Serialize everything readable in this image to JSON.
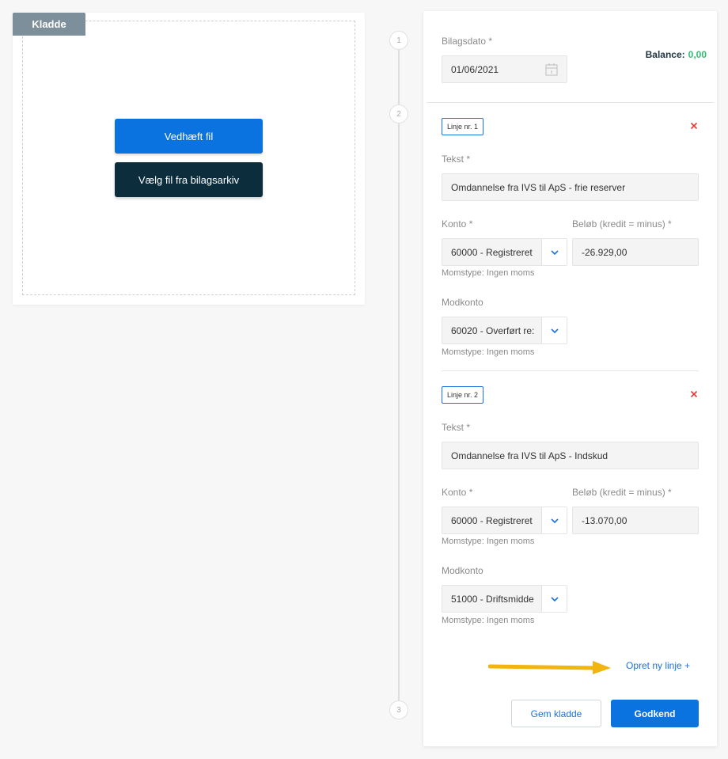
{
  "upload": {
    "tag": "Kladde",
    "attach_label": "Vedhæft fil",
    "archive_label": "Vælg fil fra bilagsarkiv"
  },
  "steps": [
    "1",
    "2",
    "3"
  ],
  "form": {
    "date_label": "Bilagsdato *",
    "date_value": "01/06/2021",
    "balance_label": "Balance:",
    "balance_value": "0,00",
    "lines": [
      {
        "badge": "Linje nr. 1",
        "text_label": "Tekst *",
        "text_value": "Omdannelse fra IVS til ApS - frie reserver",
        "account_label": "Konto *",
        "account_value": "60000 - Registreret",
        "amount_label": "Beløb (kredit = minus) *",
        "amount_value": "-26.929,00",
        "account_vat": "Momstype: Ingen moms",
        "counter_label": "Modkonto",
        "counter_value": "60020 - Overført re:",
        "counter_vat": "Momstype: Ingen moms"
      },
      {
        "badge": "Linje nr. 2",
        "text_label": "Tekst *",
        "text_value": "Omdannelse fra IVS til ApS - Indskud",
        "account_label": "Konto *",
        "account_value": "60000 - Registreret",
        "amount_label": "Beløb (kredit = minus) *",
        "amount_value": "-13.070,00",
        "account_vat": "Momstype: Ingen moms",
        "counter_label": "Modkonto",
        "counter_value": "51000 - Driftsmidde",
        "counter_vat": "Momstype: Ingen moms"
      }
    ],
    "add_line_label": "Opret ny linje +",
    "save_label": "Gem kladde",
    "approve_label": "Godkend"
  },
  "colors": {
    "primary": "#0b73e0",
    "dark": "#0b2d3c",
    "balance_value": "#2fbf71",
    "remove": "#e53935",
    "arrow": "#f2b50f"
  },
  "icons": {
    "date": "calendar-icon",
    "select": "chevron-down-icon",
    "remove": "close-icon",
    "annotation": "arrow-right-icon"
  }
}
